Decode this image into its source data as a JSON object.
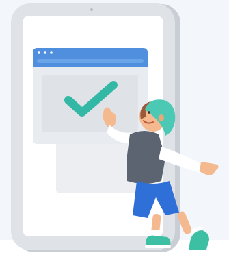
{
  "illustration": {
    "subject": "child-giving-high-five-to-checkmark-on-tablet",
    "icons": {
      "status": "checkmark-icon",
      "window_controls": "window-dots-icon"
    },
    "colors": {
      "background": "#f3f7fb",
      "tablet_frame": "#dfe3e8",
      "tablet_frame_shadow": "#c9ced5",
      "screen": "#ffffff",
      "browser_header": "#4f8fde",
      "browser_header_accent": "#6aa4e8",
      "browser_body": "#e8ebef",
      "panel_back": "#eceef1",
      "checkmark": "#34b8a6",
      "hat": "#4cc9b5",
      "shirt": "#5b6470",
      "sleeve": "#ffffff",
      "shorts": "#2f6fd8",
      "shoes": "#3dbfa3",
      "skin": "#f4b98e",
      "hair": "#9a5a3a"
    }
  }
}
